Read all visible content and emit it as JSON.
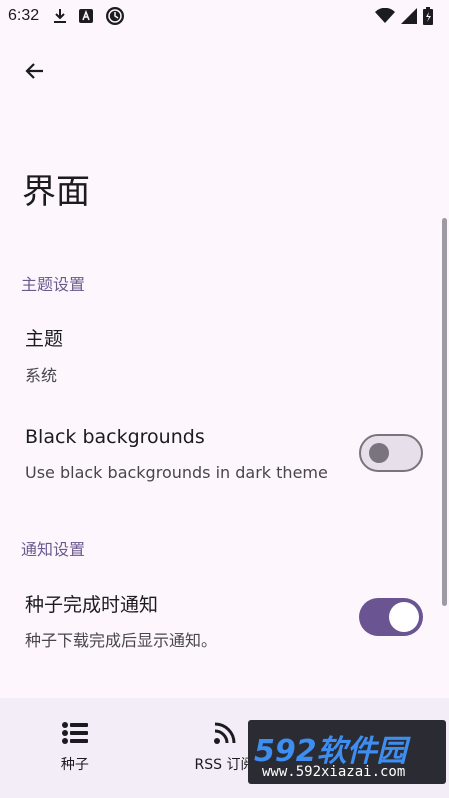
{
  "status_bar": {
    "time": "6:32",
    "left_icons": [
      "download-icon",
      "a-box-icon",
      "clock-badge-icon"
    ],
    "right_icons": [
      "wifi-icon",
      "signal-icon",
      "battery-icon"
    ]
  },
  "page": {
    "title": "界面"
  },
  "sections": {
    "theme_header": "主题设置",
    "notify_header": "通知设置"
  },
  "prefs": {
    "theme": {
      "title": "主题",
      "summary": "系统"
    },
    "black_bg": {
      "title": "Black backgrounds",
      "summary": "Use black backgrounds in dark theme",
      "enabled": false
    },
    "torrent_done": {
      "title": "种子完成时通知",
      "summary": "种子下载完成后显示通知。",
      "enabled": true
    }
  },
  "bottom_nav": {
    "items": [
      {
        "label": "种子",
        "icon": "list-icon"
      },
      {
        "label": "RSS 订阅",
        "icon": "rss-icon"
      }
    ]
  },
  "watermark": {
    "line1": "592软件园",
    "line2": "www.592xiazai.com"
  },
  "colors": {
    "background": "#fdf7fd",
    "accent": "#6b5492",
    "section_header": "#6b5a8e"
  }
}
